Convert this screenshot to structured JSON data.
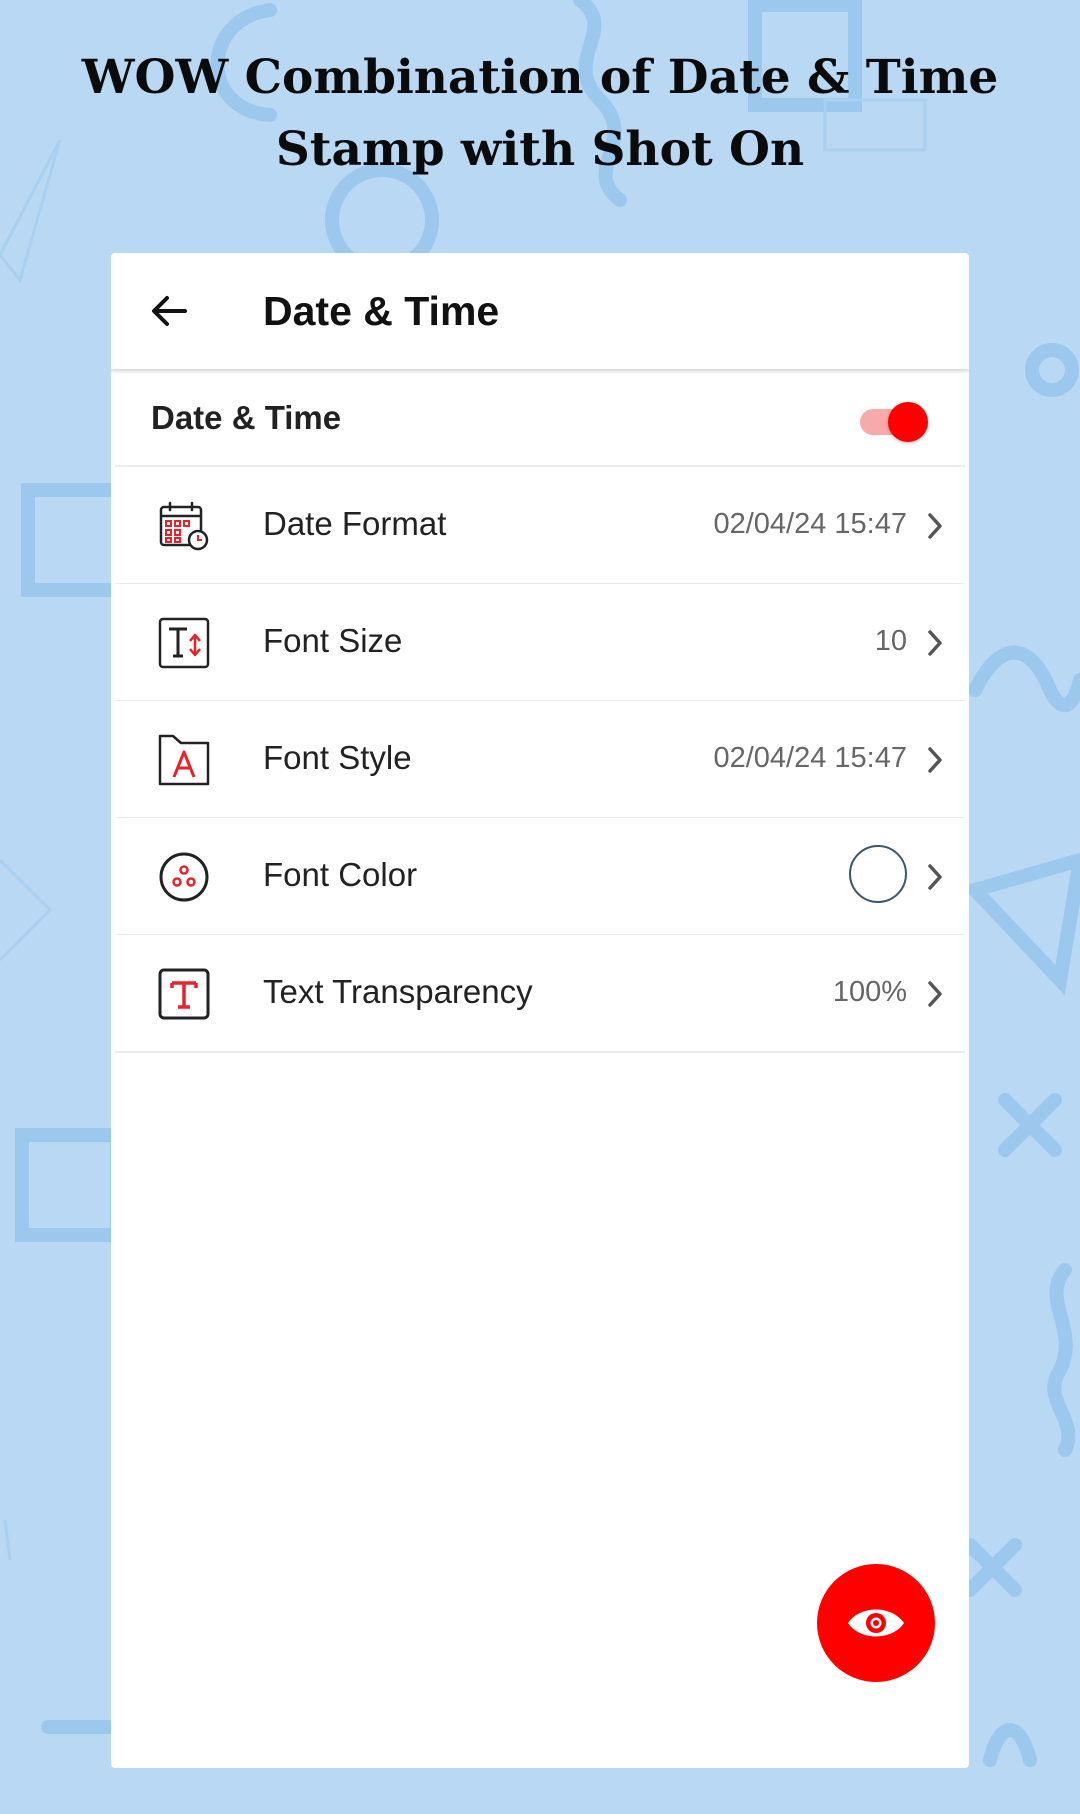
{
  "promo": {
    "title_line1": "WOW Combination of Date & Time",
    "title_line2": "Stamp with Shot On"
  },
  "appbar": {
    "back_icon": "arrow-left-icon",
    "title": "Date & Time"
  },
  "toggle": {
    "label": "Date & Time",
    "enabled": true
  },
  "settings": [
    {
      "icon": "calendar-clock-icon",
      "label": "Date Format",
      "value": "02/04/24 15:47"
    },
    {
      "icon": "text-size-icon",
      "label": "Font Size",
      "value": "10"
    },
    {
      "icon": "font-style-icon",
      "label": "Font Style",
      "value": "02/04/24 15:47"
    },
    {
      "icon": "palette-icon",
      "label": "Font Color",
      "value": "#ffffff"
    },
    {
      "icon": "text-transparency-icon",
      "label": "Text Transparency",
      "value": "100%"
    }
  ],
  "fab": {
    "icon": "eye-icon"
  },
  "colors": {
    "background": "#b9d8f3",
    "accent": "#ff0000",
    "toggle_track": "#f8a9a9"
  }
}
